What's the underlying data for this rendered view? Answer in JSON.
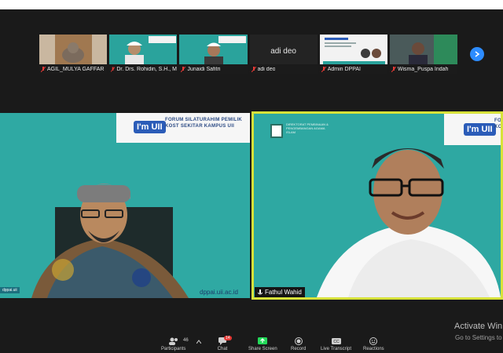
{
  "participants": [
    {
      "name": "AGIL_MULYA GAFFAR",
      "bg": "#8a6a4a"
    },
    {
      "name": "Dr. Drs. Rohidin, S.H., M.Ag.",
      "bg": "#2aa39c"
    },
    {
      "name": "Junaidi Safitri",
      "bg": "#2aa39c"
    },
    {
      "name": "adi deo",
      "bg": "#232323",
      "center_name": "adi deo"
    },
    {
      "name": "Admin DPPAI",
      "bg": "#f2f2f2"
    },
    {
      "name": "Wisma_Puspa Indah",
      "bg": "#3a3a3a"
    }
  ],
  "main_left": {
    "badge": "I'm UII",
    "banner_title_1": "FORUM SILATURAHIM PEMILIK",
    "banner_title_2": "KOST SEKITAR KAMPUS UII",
    "url": "dppai.uii.ac.id",
    "chip": "dppai.uii"
  },
  "main_right": {
    "badge": "I'm UII",
    "banner_title_1": "FO",
    "banner_title_2": "KO",
    "logo_text": "DIREKTORAT PEMBINAAN & PENGEMBANGAN AGAMA ISLAM",
    "speaker_name": "Fathul Wahid"
  },
  "toolbar": {
    "participants_label": "Participants",
    "participants_count": "46",
    "chat_label": "Chat",
    "chat_badge": "14",
    "share_label": "Share Screen",
    "record_label": "Record",
    "transcript_label": "Live Transcript",
    "reactions_label": "Reactions"
  },
  "watermark": {
    "title": "Activate Win",
    "subtitle": "Go to Settings to"
  },
  "colors": {
    "accent": "#2d8cff",
    "active_speaker_border": "#d7e23a",
    "share_green": "#23d959",
    "mic_muted_red": "#e53935"
  }
}
